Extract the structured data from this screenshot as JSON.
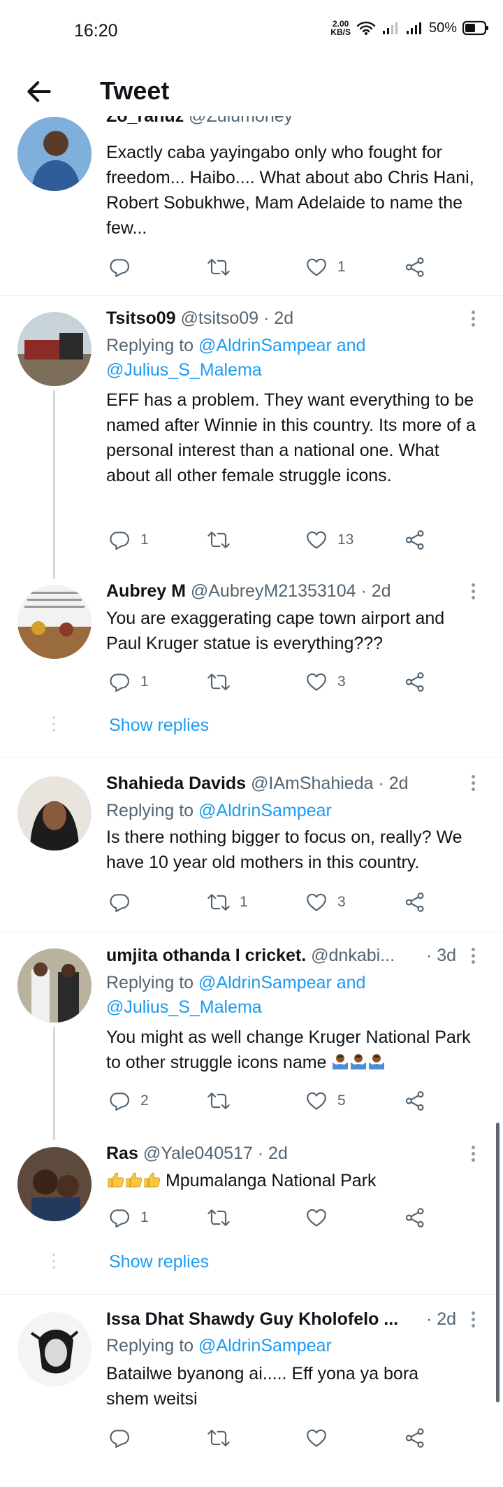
{
  "status_bar": {
    "time": "16:20",
    "speed": "2.00",
    "speed_unit": "KB/S",
    "battery": "50%"
  },
  "header": {
    "title": "Tweet"
  },
  "tweets": [
    {
      "name_partial": "Zo_ranuz",
      "handle_partial": "@Zulumoney",
      "text": "Exactly caba yayingabo only who fought for freedom... Haibo.... What about abo Chris Hani, Robert Sobukhwe, Mam Adelaide to name the few...",
      "replies": "",
      "retweets": "",
      "likes": "1"
    },
    {
      "name": "Tsitso09",
      "handle": "@tsitso09",
      "time": "· 2d",
      "replying_prefix": "Replying to ",
      "replying_to": "@AldrinSampear and @Julius_S_Malema",
      "text": "EFF has a problem. They want everything to be named after Winnie in this country. Its more of a personal interest than a national one. What about all other female struggle icons.",
      "replies": "1",
      "retweets": "",
      "likes": "13"
    },
    {
      "name": "Aubrey M",
      "handle": "@AubreyM21353104",
      "time": "· 2d",
      "text": "You are exaggerating cape town airport and Paul Kruger statue is everything???",
      "replies": "1",
      "retweets": "",
      "likes": "3"
    },
    {
      "name": "Shahieda Davids",
      "handle": "@IAmShahieda",
      "time": "· 2d",
      "replying_prefix": "Replying to ",
      "replying_to": "@AldrinSampear",
      "text": "Is there nothing bigger to focus on, really? We have 10 year old mothers in this country.",
      "replies": "",
      "retweets": "1",
      "likes": "3"
    },
    {
      "name": "umjita othanda I cricket.",
      "handle": "@dnkabi...",
      "time": "· 3d",
      "replying_prefix": "Replying to ",
      "replying_to": "@AldrinSampear and @Julius_S_Malema",
      "text": "You might as well change Kruger National Park to other struggle icons name",
      "replies": "2",
      "retweets": "",
      "likes": "5"
    },
    {
      "name": "Ras",
      "handle": "@Yale040517",
      "time": "· 2d",
      "text": "Mpumalanga National Park",
      "replies": "1",
      "retweets": "",
      "likes": ""
    },
    {
      "name": "Issa Dhat Shawdy Guy Kholofelo ...",
      "time": "· 2d",
      "replying_prefix": "Replying to ",
      "replying_to": "@AldrinSampear",
      "text": "Batailwe byanong ai..... Eff yona ya bora shem weitsi",
      "replies": "",
      "retweets": "",
      "likes": ""
    }
  ],
  "show_replies_label": "Show replies",
  "colors": {
    "accent": "#1d9bf0",
    "secondary_text": "#536471",
    "thread_line": "#cfd9de"
  }
}
